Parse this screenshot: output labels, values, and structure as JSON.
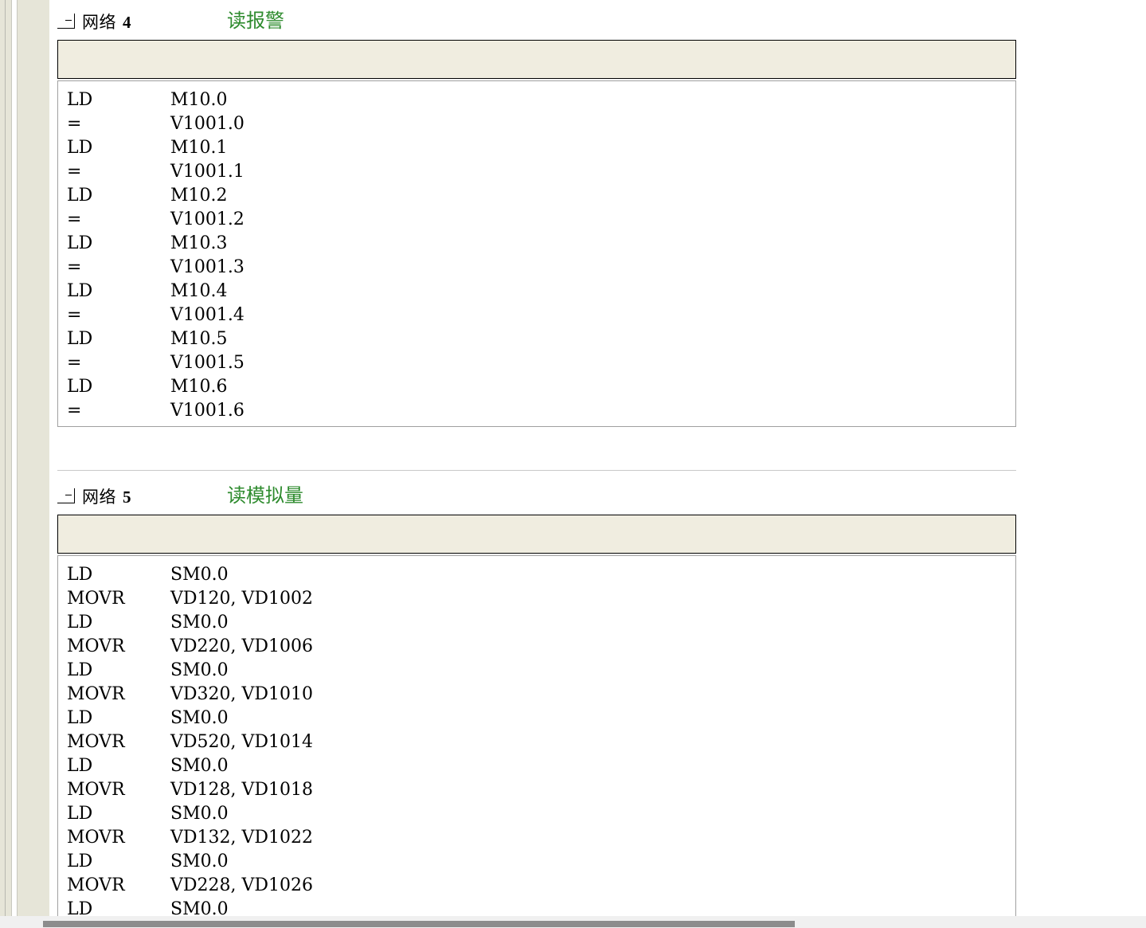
{
  "network4": {
    "label": "网络",
    "number": "4",
    "comment_title": "读报警",
    "lines": [
      {
        "op": "LD",
        "arg": "M10.0"
      },
      {
        "op": "=",
        "arg": "V1001.0"
      },
      {
        "op": "LD",
        "arg": "M10.1"
      },
      {
        "op": "=",
        "arg": "V1001.1"
      },
      {
        "op": "LD",
        "arg": "M10.2"
      },
      {
        "op": "=",
        "arg": "V1001.2"
      },
      {
        "op": "LD",
        "arg": "M10.3"
      },
      {
        "op": "=",
        "arg": "V1001.3"
      },
      {
        "op": "LD",
        "arg": "M10.4"
      },
      {
        "op": "=",
        "arg": "V1001.4"
      },
      {
        "op": "LD",
        "arg": "M10.5"
      },
      {
        "op": "=",
        "arg": "V1001.5"
      },
      {
        "op": "LD",
        "arg": "M10.6"
      },
      {
        "op": "=",
        "arg": "V1001.6"
      }
    ]
  },
  "network5": {
    "label": "网络",
    "number": "5",
    "comment_title": "读模拟量",
    "lines": [
      {
        "op": "LD",
        "arg": "SM0.0"
      },
      {
        "op": "MOVR",
        "arg": "VD120, VD1002"
      },
      {
        "op": "LD",
        "arg": "SM0.0"
      },
      {
        "op": "MOVR",
        "arg": "VD220, VD1006"
      },
      {
        "op": "LD",
        "arg": "SM0.0"
      },
      {
        "op": "MOVR",
        "arg": "VD320, VD1010"
      },
      {
        "op": "LD",
        "arg": "SM0.0"
      },
      {
        "op": "MOVR",
        "arg": "VD520, VD1014"
      },
      {
        "op": "LD",
        "arg": "SM0.0"
      },
      {
        "op": "MOVR",
        "arg": "VD128, VD1018"
      },
      {
        "op": "LD",
        "arg": "SM0.0"
      },
      {
        "op": "MOVR",
        "arg": "VD132, VD1022"
      },
      {
        "op": "LD",
        "arg": "SM0.0"
      },
      {
        "op": "MOVR",
        "arg": "VD228, VD1026"
      },
      {
        "op": "LD",
        "arg": "SM0.0"
      }
    ]
  },
  "colors": {
    "comment_green": "#2e8b2e",
    "comment_box_bg": "#f0ede0",
    "gutter_bg": "#e6e5d8"
  }
}
